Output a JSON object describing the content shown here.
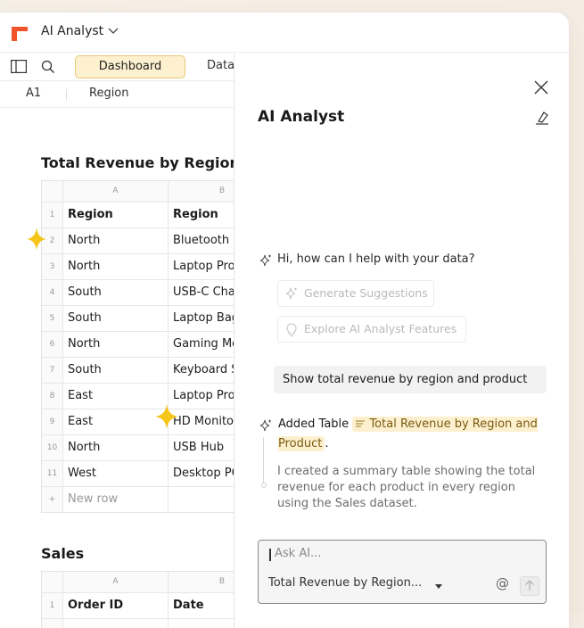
{
  "app": {
    "title": "AI Analyst"
  },
  "toolbar": {
    "tabs": [
      {
        "label": "Dashboard"
      },
      {
        "label": "Data"
      }
    ]
  },
  "formula_bar": {
    "cell_ref": "A1",
    "value": "Region"
  },
  "sheet": {
    "tables": [
      {
        "title": "Total Revenue by Region a",
        "column_headers": [
          "A",
          "B"
        ],
        "rows": [
          {
            "num": "1",
            "a": "Region",
            "b": "Region"
          },
          {
            "num": "2",
            "a": "North",
            "b": "Bluetooth M"
          },
          {
            "num": "3",
            "a": "North",
            "b": "Laptop Pro"
          },
          {
            "num": "4",
            "a": "South",
            "b": "USB-C Cha"
          },
          {
            "num": "5",
            "a": "South",
            "b": "Laptop Bag"
          },
          {
            "num": "6",
            "a": "North",
            "b": "Gaming Mo"
          },
          {
            "num": "7",
            "a": "South",
            "b": "Keyboard S"
          },
          {
            "num": "8",
            "a": "East",
            "b": "Laptop Pro"
          },
          {
            "num": "9",
            "a": "East",
            "b": "HD Monitor"
          },
          {
            "num": "10",
            "a": "North",
            "b": "USB Hub"
          },
          {
            "num": "11",
            "a": "West",
            "b": "Desktop PC"
          }
        ],
        "new_row": {
          "num": "+",
          "label": "New row"
        }
      },
      {
        "title": "Sales",
        "column_headers": [
          "A",
          "B"
        ],
        "rows": [
          {
            "num": "1",
            "a": "Order ID",
            "b": "Date"
          }
        ]
      }
    ]
  },
  "panel": {
    "title": "AI Analyst",
    "greeting": "Hi, how can I help with your data?",
    "suggestions": [
      {
        "label": "Generate Suggestions",
        "icon": "sparkle-icon"
      },
      {
        "label": "Explore AI Analyst Features",
        "icon": "lightbulb-icon"
      }
    ],
    "user_message": "Show total revenue by region and product",
    "response": {
      "prefix": "Added Table",
      "table_name": "Total Revenue by Region and Product",
      "suffix": ".",
      "explanation": "I created a summary table showing the total revenue for each product in every region using the Sales dataset."
    },
    "composer": {
      "placeholder": "Ask AI...",
      "context": "Total Revenue by Region...",
      "mention": "@"
    }
  },
  "colors": {
    "accent": "#fdf0cf",
    "accent_border": "#e9c97b",
    "logo": "#f0522a",
    "sparkle": "#f5c518"
  }
}
